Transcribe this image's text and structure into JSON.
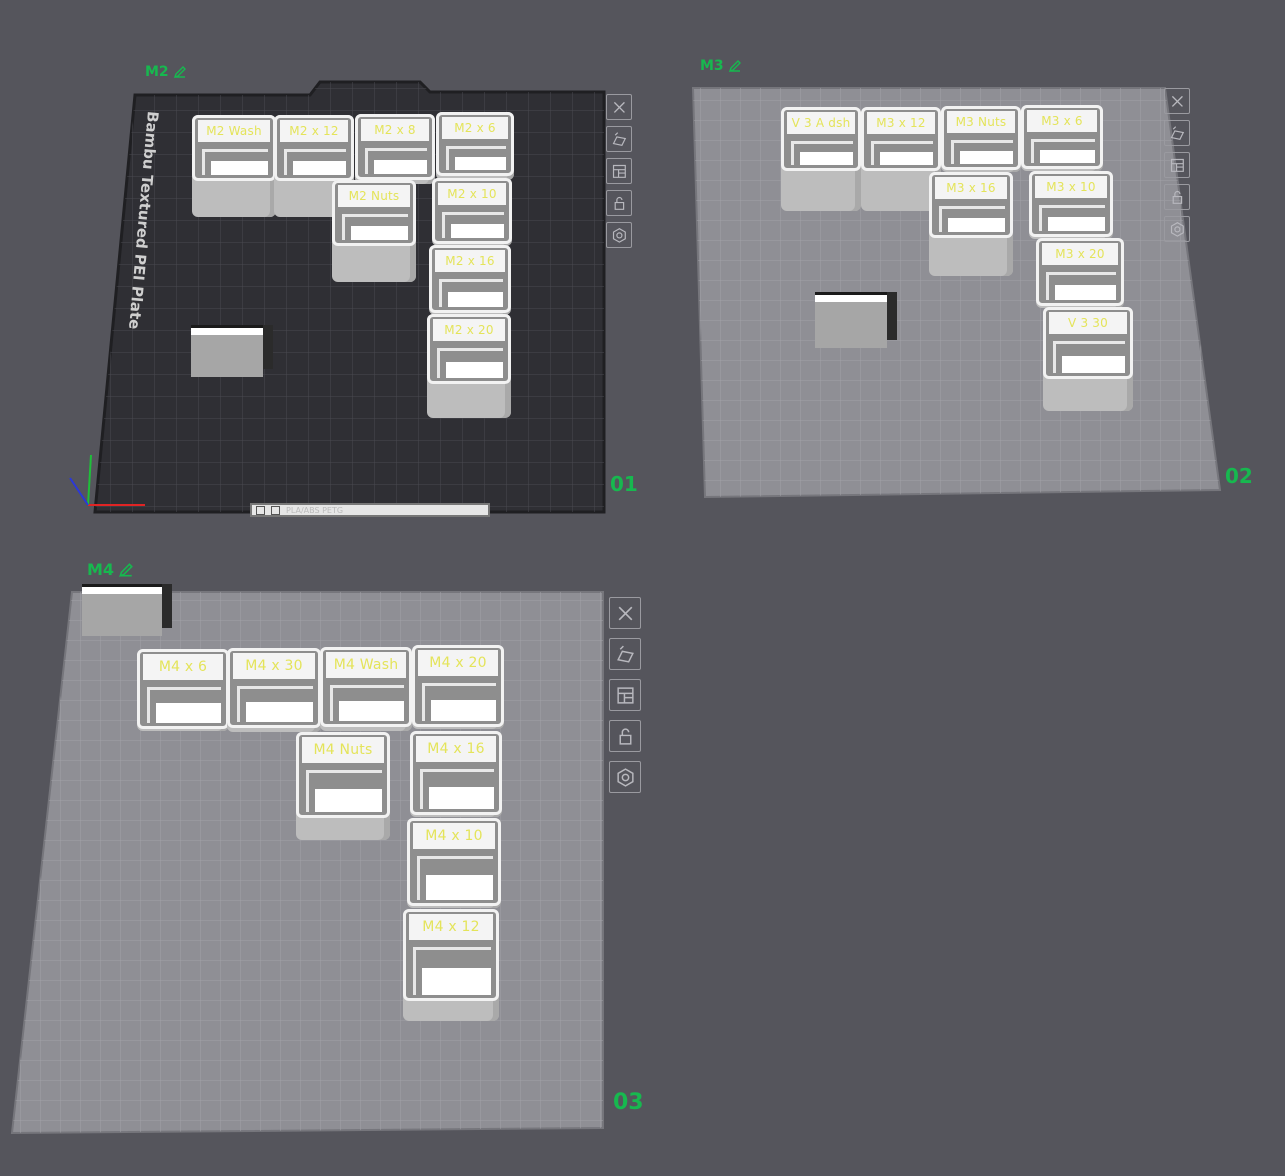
{
  "colors": {
    "background": "#55555c",
    "accent_green": "#17b84f",
    "label_text": "#e4e45a",
    "dark_plate": "#2f2f34",
    "light_plate": "#8f8f95"
  },
  "plates": [
    {
      "name": "M2",
      "number": "01",
      "brand_text": "Bambu Textured PEI Plate",
      "bed_strip_text": "PLA/ABS PETG",
      "bins": [
        "M2 Wash",
        "M2 x 12",
        "M2 x 8",
        "M2 x 6",
        "M2 Nuts",
        "M2 x 10",
        "M2 x 16",
        "M2 x 20"
      ]
    },
    {
      "name": "M3",
      "number": "02",
      "bins": [
        "V 3 A dsh",
        "M3 x 12",
        "M3 Nuts",
        "M3 x 6",
        "M3 x 16",
        "M3 x 10",
        "M3 x 20",
        "V 3 30"
      ]
    },
    {
      "name": "M4",
      "number": "03",
      "bins": [
        "M4 x 6",
        "M4 x 30",
        "M4 Wash",
        "M4 x 20",
        "M4 Nuts",
        "M4 x 16",
        "M4 x 10",
        "M4 x 12"
      ]
    }
  ],
  "toolbar_icons": [
    "close-icon",
    "auto-orient-icon",
    "arrange-icon",
    "lock-icon",
    "settings-icon"
  ]
}
